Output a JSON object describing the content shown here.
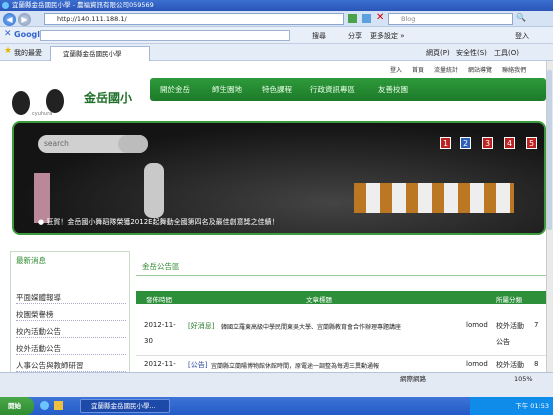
{
  "window": {
    "title": "宜蘭縣金岳國民小學 - 農福資訊有限公司059569"
  },
  "address": {
    "url": "http://140.111.188.1/",
    "search_placeholder": "Blog"
  },
  "google": {
    "logo": "Google",
    "search_label": "搜尋",
    "share": "分享",
    "more": "更多設定 »",
    "login": "登入"
  },
  "tabs": {
    "favorites": "我的最愛",
    "tab1": "宜蘭縣金岳國民小學"
  },
  "toolbar": {
    "page": "網頁(P)",
    "safety": "安全性(S)",
    "tools": "工具(O)"
  },
  "site": {
    "top_links": [
      "登入",
      "首頁",
      "流量統計",
      "網站導覽",
      "聯絡我們"
    ],
    "logo_text": "金岳國小",
    "logo_sub": "cyuhura",
    "nav": [
      "開於金岳",
      "師生園地",
      "特色課程",
      "行政資訊專區",
      "友善校園"
    ],
    "banner_search": "search",
    "slides": [
      "1",
      "2",
      "3",
      "4",
      "5"
    ],
    "marquee": "● 狂賀！金岳國小舞蹈隊榮獲2012E起舞動全國第四名及最佳創意獎之佳績！",
    "left_head": "最新消息",
    "left_items": [
      "平面媒體報導",
      "校園榮譽榜",
      "校內活動公告",
      "校外活動公告",
      "人事公告與教師研習"
    ],
    "right_head": "金岳公告區",
    "table_headers": [
      "發佈時間",
      "文章標題",
      "所屬分類"
    ],
    "rows": [
      {
        "date": "2012-11-",
        "date2": "30",
        "tag": "[好消息]",
        "title": "韓國立羅東高級中學民間東吳大學、宜蘭縣教育會合作辦理專題講座",
        "author": "lomod",
        "cat": "校外活動",
        "cat2": "公告",
        "count": "7"
      },
      {
        "date": "2012-11-",
        "date2": "",
        "tag": "[公告]",
        "title": "宜蘭縣立蘭陽博物館休館時間，原電途一調整為每週三異動通報",
        "author": "lomod",
        "cat": "校外活動",
        "cat2": "",
        "count": "8"
      }
    ]
  },
  "status": {
    "zone": "網際網路",
    "zoom": "105%"
  },
  "taskbar": {
    "start": "開始",
    "task1": "宜蘭縣金岳國民小學...",
    "clock": "下午 01:53"
  }
}
